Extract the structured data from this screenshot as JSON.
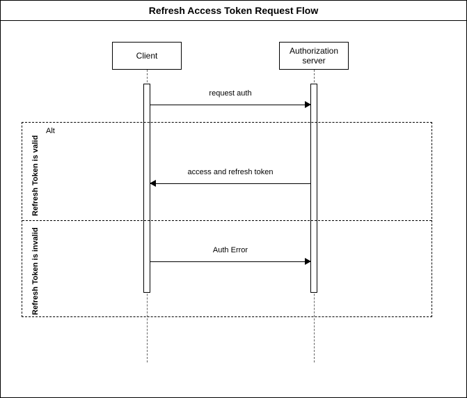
{
  "title": "Refresh Access Token Request Flow",
  "participants": {
    "client": "Client",
    "auth_server": "Authorization server"
  },
  "messages": {
    "request_auth": "request auth",
    "access_refresh": "access and refresh token",
    "auth_error": "Auth Error"
  },
  "alt": {
    "keyword": "Alt",
    "valid_label": "Refresh Token is valid",
    "invalid_label": "Refresh Token is invalid"
  }
}
